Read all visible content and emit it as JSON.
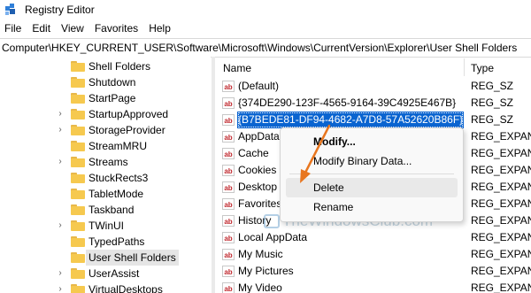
{
  "window": {
    "title": "Registry Editor"
  },
  "menubar": {
    "items": [
      "File",
      "Edit",
      "View",
      "Favorites",
      "Help"
    ]
  },
  "address": {
    "path": "Computer\\HKEY_CURRENT_USER\\Software\\Microsoft\\Windows\\CurrentVersion\\Explorer\\User Shell Folders"
  },
  "tree": {
    "items": [
      {
        "label": "Shell Folders",
        "expander": ""
      },
      {
        "label": "Shutdown",
        "expander": ""
      },
      {
        "label": "StartPage",
        "expander": ""
      },
      {
        "label": "StartupApproved",
        "expander": "›"
      },
      {
        "label": "StorageProvider",
        "expander": "›"
      },
      {
        "label": "StreamMRU",
        "expander": ""
      },
      {
        "label": "Streams",
        "expander": "›"
      },
      {
        "label": "StuckRects3",
        "expander": ""
      },
      {
        "label": "TabletMode",
        "expander": ""
      },
      {
        "label": "Taskband",
        "expander": ""
      },
      {
        "label": "TWinUI",
        "expander": "›"
      },
      {
        "label": "TypedPaths",
        "expander": ""
      },
      {
        "label": "User Shell Folders",
        "expander": "",
        "selected": true
      },
      {
        "label": "UserAssist",
        "expander": "›"
      },
      {
        "label": "VirtualDesktops",
        "expander": "›"
      }
    ]
  },
  "list": {
    "headers": {
      "name": "Name",
      "type": "Type"
    },
    "icon_text": "ab",
    "rows": [
      {
        "name": "(Default)",
        "type": "REG_SZ"
      },
      {
        "name": "{374DE290-123F-4565-9164-39C4925E467B}",
        "type": "REG_SZ"
      },
      {
        "name": "{B7BEDE81-DF94-4682-A7D8-57A52620B86F}",
        "type": "REG_SZ",
        "selected": true
      },
      {
        "name": "AppData",
        "type": "REG_EXPAND"
      },
      {
        "name": "Cache",
        "type": "REG_EXPAND"
      },
      {
        "name": "Cookies",
        "type": "REG_EXPAND"
      },
      {
        "name": "Desktop",
        "type": "REG_EXPAND"
      },
      {
        "name": "Favorites",
        "type": "REG_EXPAND"
      },
      {
        "name": "History",
        "type": "REG_EXPAND"
      },
      {
        "name": "Local AppData",
        "type": "REG_EXPAND"
      },
      {
        "name": "My Music",
        "type": "REG_EXPAND"
      },
      {
        "name": "My Pictures",
        "type": "REG_EXPAND"
      },
      {
        "name": "My Video",
        "type": "REG_EXPAND"
      }
    ]
  },
  "context_menu": {
    "modify": "Modify...",
    "modify_binary": "Modify Binary Data...",
    "delete": "Delete",
    "rename": "Rename"
  },
  "watermark": {
    "text": "TheWindowsClub.com"
  },
  "colors": {
    "selection": "#0a64d0",
    "arrow": "#e8761f",
    "folder": "#f6c94f"
  }
}
